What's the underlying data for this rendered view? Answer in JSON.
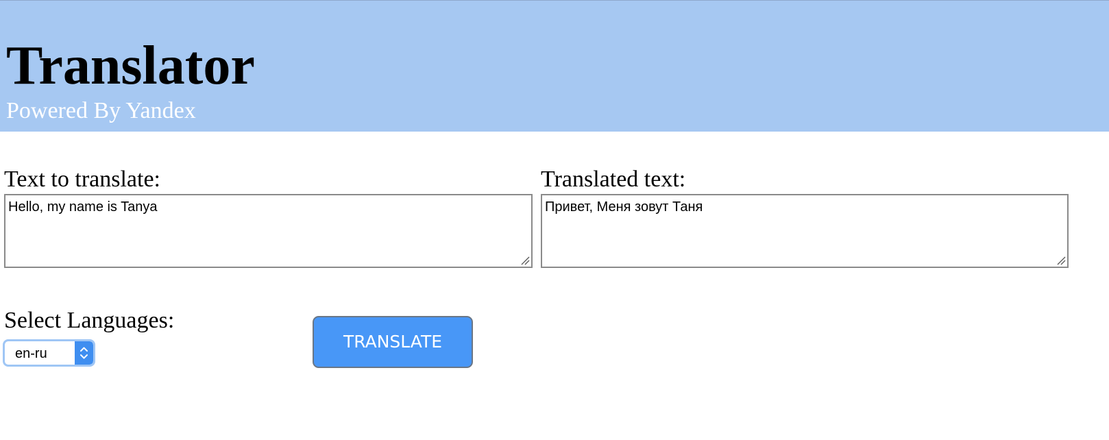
{
  "header": {
    "title": "Translator",
    "subtitle": "Powered By Yandex"
  },
  "source": {
    "label": "Text to translate:",
    "value": "Hello, my name is Tanya"
  },
  "target": {
    "label": "Translated text:",
    "value": "Привет, Меня зовут Таня"
  },
  "languages": {
    "label": "Select Languages:",
    "selected": "en-ru"
  },
  "actions": {
    "translate_label": "TRANSLATE"
  },
  "colors": {
    "header_bg": "#a6c8f2",
    "subtitle_text": "#ffffff",
    "button_bg": "#4897f7",
    "select_focus_ring": "#9fc6f5",
    "select_arrow_bg": "#3f8ef0"
  },
  "icons": {
    "resize_grip": "resize-grip-icon",
    "select_arrows": "up-down-chevron-icon"
  }
}
